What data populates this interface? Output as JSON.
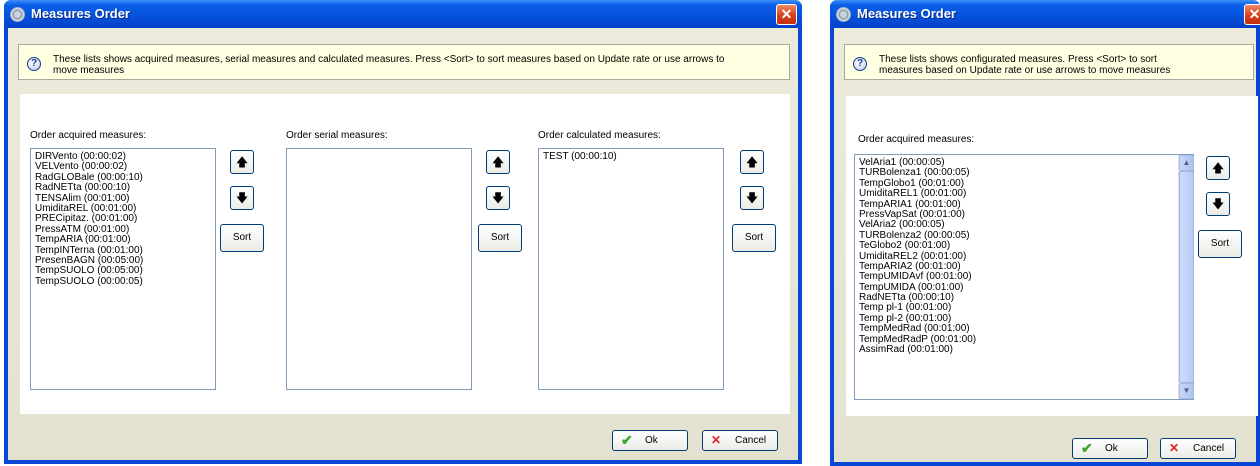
{
  "dialog1": {
    "title": "Measures Order",
    "close": "✕",
    "info": {
      "line1": "These lists shows acquired measures, serial measures and calculated measures. Press <Sort> to sort measures based on Update rate or use arrows to",
      "line2": "move measures"
    },
    "lists": [
      {
        "label": "Order acquired measures:",
        "items": [
          "DIRVento (00:00:02)",
          "VELVento (00:00:02)",
          "RadGLOBale (00:00:10)",
          "RadNETta (00:00:10)",
          "TENSAlim (00:01:00)",
          "UmiditaREL (00:01:00)",
          "PRECipitaz. (00:01:00)",
          "PressATM (00:01:00)",
          "TempARIA (00:01:00)",
          "TempINTerna (00:01:00)",
          "PresenBAGN (00:05:00)",
          "TempSUOLO (00:05:00)",
          "TempSUOLO (00:00:05)"
        ]
      },
      {
        "label": "Order serial measures:",
        "items": []
      },
      {
        "label": "Order calculated measures:",
        "items": [
          "TEST (00:00:10)"
        ]
      }
    ],
    "buttons": {
      "up": "🡅",
      "down": "🡇",
      "sort": "Sort",
      "ok": "Ok",
      "cancel": "Cancel"
    }
  },
  "dialog2": {
    "title": "Measures Order",
    "close": "✕",
    "info": {
      "line1": "These lists shows configurated measures. Press <Sort> to sort",
      "line2": "measures based on Update rate or use arrows to move measures"
    },
    "list": {
      "label": "Order acquired measures:",
      "items": [
        "VelAria1 (00:00:05)",
        "TURBolenza1 (00:00:05)",
        "TempGlobo1 (00:01:00)",
        "UmiditaREL1 (00:01:00)",
        "TempARIA1 (00:01:00)",
        "PressVapSat (00:01:00)",
        "VelAria2 (00:00:05)",
        "TURBolenza2 (00:00:05)",
        "TeGlobo2 (00:01:00)",
        "UmiditaREL2 (00:01:00)",
        "TempARIA2 (00:01:00)",
        "TempUMIDAvf (00:01:00)",
        "TempUMIDA (00:01:00)",
        "RadNETta (00:00:10)",
        "Temp pl-1 (00:01:00)",
        "Temp pl-2 (00:01:00)",
        "TempMedRad (00:01:00)",
        "TempMedRadP (00:01:00)",
        "AssimRad (00:01:00)"
      ]
    },
    "buttons": {
      "up": "🡅",
      "down": "🡇",
      "sort": "Sort",
      "ok": "Ok",
      "cancel": "Cancel"
    }
  },
  "colors": {
    "titlebar": "#0653dc",
    "close": "#d8401a",
    "dialog_bg": "#eceadb",
    "info_bg": "#ffffe1"
  },
  "icons": {
    "title": "gear-icon",
    "info": "question-icon",
    "up": "arrow-up-icon",
    "down": "arrow-down-icon",
    "ok": "check-icon",
    "cancel": "x-icon"
  }
}
